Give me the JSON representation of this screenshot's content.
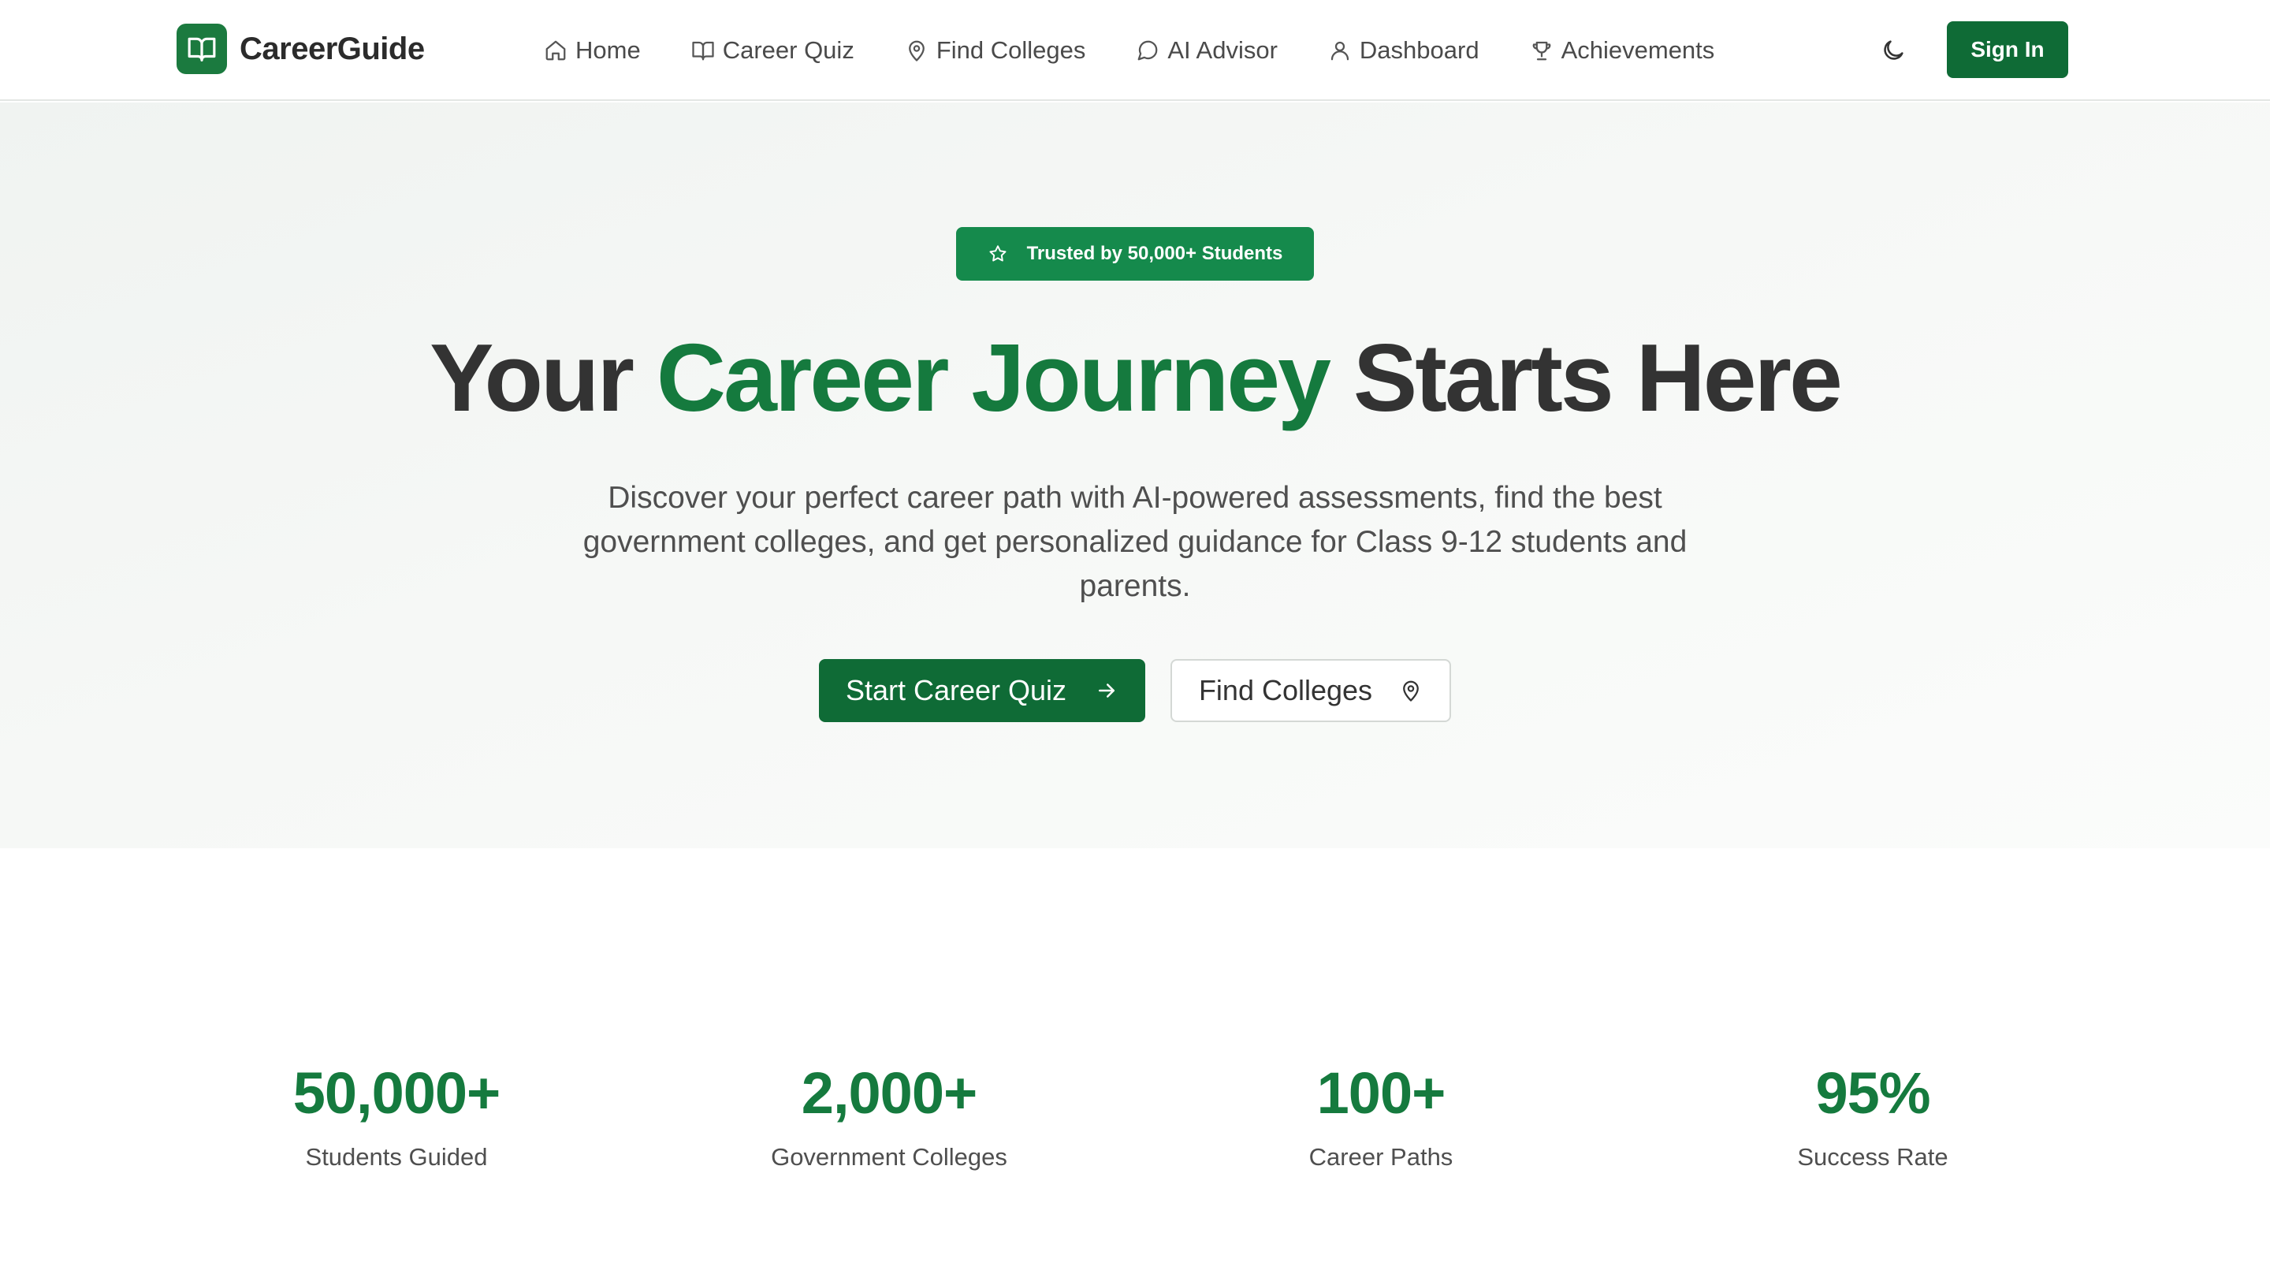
{
  "brand": {
    "name": "CareerGuide",
    "icon": "book-open-icon"
  },
  "nav": {
    "items": [
      {
        "label": "Home",
        "icon": "home-icon"
      },
      {
        "label": "Career Quiz",
        "icon": "book-open-icon"
      },
      {
        "label": "Find Colleges",
        "icon": "map-pin-icon"
      },
      {
        "label": "AI Advisor",
        "icon": "message-circle-icon"
      },
      {
        "label": "Dashboard",
        "icon": "user-icon"
      },
      {
        "label": "Achievements",
        "icon": "trophy-icon"
      }
    ]
  },
  "header": {
    "theme_toggle_icon": "moon-icon",
    "signin_label": "Sign In"
  },
  "hero": {
    "badge": "Trusted by 50,000+ Students",
    "badge_icon": "star-icon",
    "title_part1": "Your",
    "title_accent": "Career Journey",
    "title_part2": "Starts Here",
    "subtitle": "Discover your perfect career path with AI-powered assessments, find the best government colleges, and get personalized guidance for Class 9-12 students and parents.",
    "primary_cta": "Start Career Quiz",
    "primary_cta_icon": "arrow-right-icon",
    "secondary_cta": "Find Colleges",
    "secondary_cta_icon": "map-pin-icon"
  },
  "stats": [
    {
      "value": "50,000+",
      "label": "Students Guided"
    },
    {
      "value": "2,000+",
      "label": "Government Colleges"
    },
    {
      "value": "100+",
      "label": "Career Paths"
    },
    {
      "value": "95%",
      "label": "Success Rate"
    }
  ],
  "colors": {
    "primary": "#0f6b36",
    "accent_text": "#157a3e",
    "badge": "#158a4c",
    "text": "#333333"
  }
}
